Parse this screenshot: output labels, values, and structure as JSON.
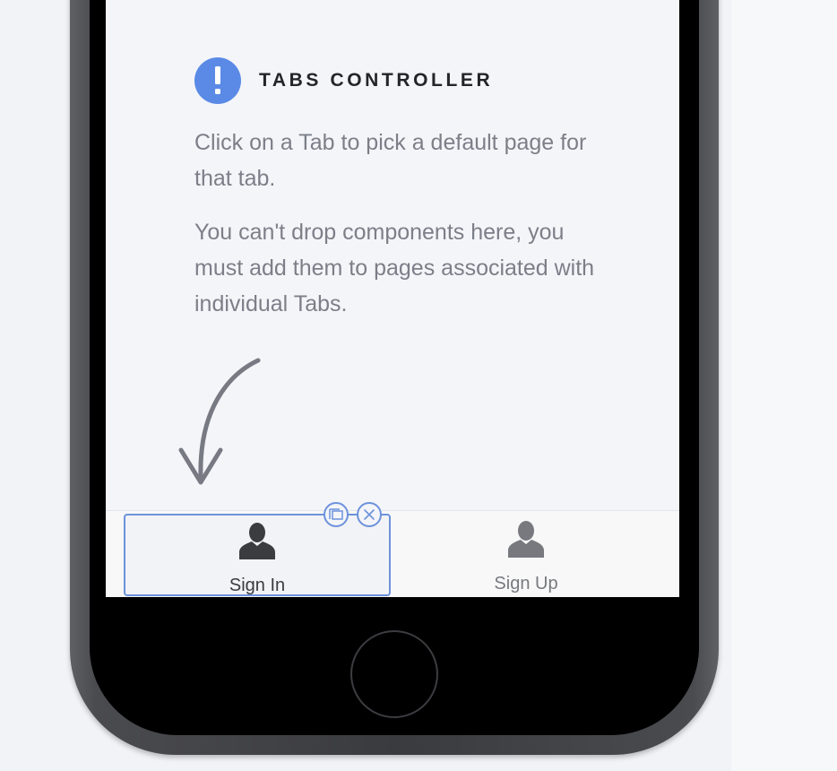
{
  "panel": {
    "title": "TABS CONTROLLER",
    "paragraph_1": "Click on a Tab to pick a default page for that tab.",
    "paragraph_2": "You can't drop components here, you must add them to pages associated with individual Tabs.",
    "icon": "exclamation-icon",
    "accent_color": "#5a8ae6"
  },
  "tabbar": {
    "tabs": [
      {
        "label": "Sign In",
        "icon": "user-icon",
        "selected": true
      },
      {
        "label": "Sign Up",
        "icon": "user-icon",
        "selected": false
      }
    ],
    "tools": [
      "duplicate-icon",
      "close-icon"
    ],
    "selection_color": "#6d92dc"
  }
}
